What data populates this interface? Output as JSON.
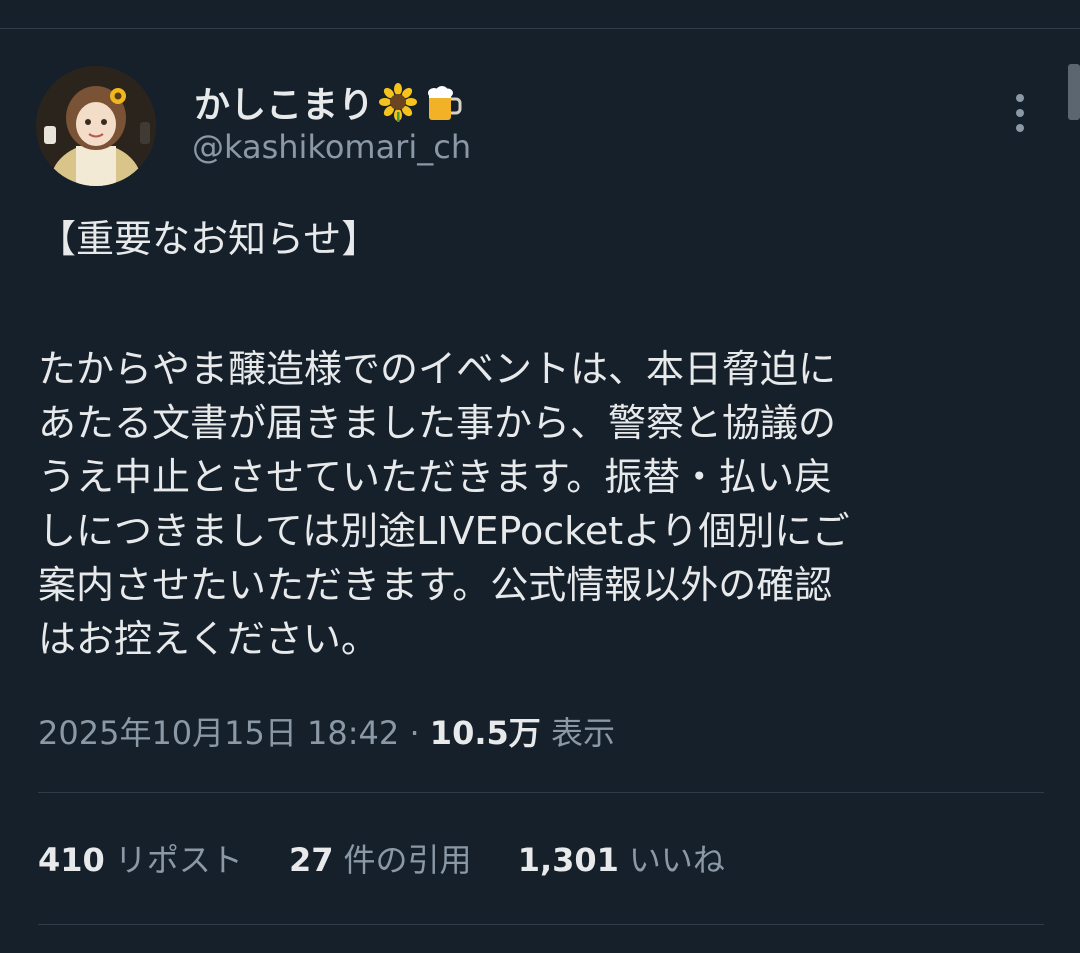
{
  "author": {
    "display_name": "かしこまり",
    "name_emojis": [
      "sunflower-icon",
      "beer-mug-icon"
    ],
    "handle": "@kashikomari_ch"
  },
  "tweet": {
    "heading": "【重要なお知らせ】",
    "lines": [
      "たからやま醸造様でのイベントは、本日脅迫に",
      "あたる文書が届きました事から、警察と協議の",
      "うえ中止とさせていただきます。振替・払い戻",
      "しにつきましては別途LIVEPocketより個別にご",
      "案内させたいただきます。公式情報以外の確認",
      "はお控えください。"
    ]
  },
  "meta": {
    "timestamp": "2025年10月15日 18:42",
    "separator": " · ",
    "views_count": "10.5万",
    "views_label": " 表示"
  },
  "stats": {
    "reposts_count": "410",
    "reposts_label": "リポスト",
    "quotes_count": "27",
    "quotes_label": "件の引用",
    "likes_count": "1,301",
    "likes_label": "いいね"
  },
  "colors": {
    "background": "#15202b",
    "primary_text": "#e7e9ea",
    "secondary_text": "#8b98a5",
    "divider": "#2f3b47"
  }
}
